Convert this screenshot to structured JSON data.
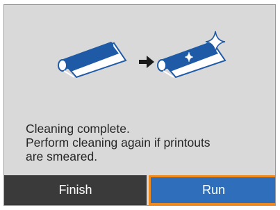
{
  "message": {
    "line1": "Cleaning complete.",
    "line2": "Perform cleaning again if printouts",
    "line3": "are smeared."
  },
  "buttons": {
    "finish_label": "Finish",
    "run_label": "Run"
  },
  "colors": {
    "screen_bg": "#d9d9d9",
    "finish_bg": "#3a3a3a",
    "run_bg": "#2f6eba",
    "focus_outline": "#f08a1c",
    "roller_blue": "#1f5aa6"
  },
  "icons": {
    "before": "dirty-roller-icon",
    "arrow": "arrow-right-icon",
    "after": "clean-roller-icon"
  }
}
